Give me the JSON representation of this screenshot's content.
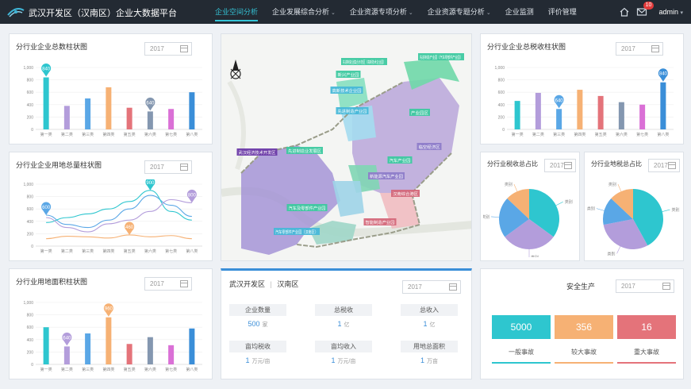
{
  "header": {
    "app_title": "武汉开发区（汉南区）企业大数据平台",
    "nav": [
      {
        "label": "企业空间分析",
        "active": true,
        "has_menu": false
      },
      {
        "label": "企业发展综合分析",
        "active": false,
        "has_menu": true
      },
      {
        "label": "企业资源专项分析",
        "active": false,
        "has_menu": true
      },
      {
        "label": "企业资源专题分析",
        "active": false,
        "has_menu": true
      },
      {
        "label": "企业监测",
        "active": false,
        "has_menu": false
      },
      {
        "label": "评价管理",
        "active": false,
        "has_menu": false
      }
    ],
    "notification_count": "10",
    "user": "admin",
    "user_caret": "▾"
  },
  "panels": {
    "enterprise_count": {
      "title": "分行业企业总数柱状图",
      "year": "2017"
    },
    "land_use": {
      "title": "分行业企业用地总量柱状图",
      "year": "2017"
    },
    "land_area": {
      "title": "分行业用地面积柱状图",
      "year": "2017"
    },
    "revenue": {
      "title": "分行业企业总税收柱状图",
      "year": "2017"
    },
    "pie_tax": {
      "title": "分行业税收总占比",
      "year": "2017"
    },
    "pie_land": {
      "title": "分行业地税总占比",
      "year": "2017"
    },
    "district": {
      "name1": "武汉开发区",
      "sep": "|",
      "name2": "汉南区",
      "year": "2017",
      "stats": [
        {
          "label": "企业数量",
          "value": "500",
          "unit": "家"
        },
        {
          "label": "总税收",
          "value": "1",
          "unit": "亿"
        },
        {
          "label": "总收入",
          "value": "1",
          "unit": "亿"
        },
        {
          "label": "亩均税收",
          "value": "1",
          "unit": "万元/亩"
        },
        {
          "label": "亩均收入",
          "value": "1",
          "unit": "万元/亩"
        },
        {
          "label": "用地总面积",
          "value": "1",
          "unit": "万亩"
        }
      ]
    },
    "safety": {
      "title": "安全生产",
      "year": "2017",
      "items": [
        {
          "value": "5000",
          "label": "一般事故",
          "color": "#2ec6cf"
        },
        {
          "value": "356",
          "label": "较大事故",
          "color": "#f6b174"
        },
        {
          "value": "16",
          "label": "重大事故",
          "color": "#e4737a"
        }
      ]
    }
  },
  "map": {
    "labels": [
      "先进制造业集合示范区（高新技术企业园）",
      "新兴产业园",
      "高新技术企业园",
      "先进制造产业园（汽车零部件产业园）",
      "先进制造产业园",
      "产业园区",
      "临空经济区",
      "武汉经济技术开发区",
      "先进制造业发展区",
      "汽车产业园",
      "新能源汽车产业园",
      "汽车及零部件产业园",
      "汽车零部件产业园（汉南区）",
      "汉南综合港区",
      "智能制造产业园"
    ]
  },
  "chart_data": [
    {
      "type": "bar",
      "title": "分行业企业总数柱状图",
      "categories": [
        "第一类",
        "第二类",
        "第三类",
        "第四类",
        "第五类",
        "第六类",
        "第七类",
        "第八类"
      ],
      "values": [
        840,
        380,
        500,
        680,
        350,
        290,
        330,
        600
      ],
      "colors": [
        "#2ec6cf",
        "#b39ddb",
        "#5aa7e6",
        "#f6b174",
        "#e4737a",
        "#8497b0",
        "#da70d6",
        "#3a8ed8"
      ],
      "callouts": [
        {
          "index": 0,
          "label": "840"
        },
        {
          "index": 5,
          "label": "640"
        }
      ],
      "ylim": [
        0,
        1000
      ],
      "yticks": [
        "0",
        "200",
        "400",
        "600",
        "800",
        "1,000"
      ]
    },
    {
      "type": "line",
      "title": "分行业企业用地总量柱状图",
      "categories": [
        "第一类",
        "第二类",
        "第三类",
        "第四类",
        "第五类",
        "第六类",
        "第七类",
        "第八类"
      ],
      "series": [
        {
          "color": "#5aa7e6",
          "values": [
            500,
            350,
            300,
            420,
            600,
            820,
            660,
            480
          ]
        },
        {
          "color": "#2ec6cf",
          "values": [
            380,
            460,
            520,
            600,
            720,
            900,
            560,
            420
          ]
        },
        {
          "color": "#b39ddb",
          "values": [
            460,
            300,
            230,
            360,
            420,
            560,
            750,
            700
          ]
        },
        {
          "color": "#f6b174",
          "values": [
            120,
            160,
            150,
            130,
            180,
            150,
            170,
            120
          ]
        }
      ],
      "callouts": [
        {
          "series": 0,
          "index": 0,
          "label": "600"
        },
        {
          "series": 1,
          "index": 5,
          "label": "900"
        },
        {
          "series": 3,
          "index": 4,
          "label": "460"
        },
        {
          "series": 2,
          "index": 7,
          "label": "800"
        }
      ],
      "ylim": [
        0,
        1000
      ],
      "yticks": [
        "0",
        "200",
        "400",
        "600",
        "800",
        "1,000"
      ]
    },
    {
      "type": "bar",
      "title": "分行业用地面积柱状图",
      "categories": [
        "第一类",
        "第二类",
        "第三类",
        "第四类",
        "第五类",
        "第六类",
        "第七类",
        "第八类"
      ],
      "values": [
        600,
        290,
        500,
        760,
        330,
        440,
        310,
        580
      ],
      "colors": [
        "#2ec6cf",
        "#b39ddb",
        "#5aa7e6",
        "#f6b174",
        "#e4737a",
        "#8497b0",
        "#da70d6",
        "#3a8ed8"
      ],
      "callouts": [
        {
          "index": 1,
          "label": "640"
        },
        {
          "index": 3,
          "label": "960"
        }
      ],
      "ylim": [
        0,
        1000
      ],
      "yticks": [
        "0",
        "200",
        "400",
        "600",
        "800",
        "1,000"
      ]
    },
    {
      "type": "bar",
      "title": "分行业企业总税收柱状图",
      "categories": [
        "第一类",
        "第二类",
        "第三类",
        "第四类",
        "第五类",
        "第六类",
        "第七类",
        "第八类"
      ],
      "values": [
        460,
        590,
        330,
        640,
        540,
        440,
        400,
        760
      ],
      "colors": [
        "#2ec6cf",
        "#b39ddb",
        "#5aa7e6",
        "#f6b174",
        "#e4737a",
        "#8497b0",
        "#da70d6",
        "#3a8ed8"
      ],
      "callouts": [
        {
          "index": 2,
          "label": "640"
        },
        {
          "index": 7,
          "label": "840"
        }
      ],
      "ylim": [
        0,
        1000
      ],
      "yticks": [
        "0",
        "200",
        "400",
        "600",
        "800",
        "1,000"
      ]
    },
    {
      "type": "pie",
      "title": "分行业税收总占比",
      "values": [
        35,
        30,
        22,
        13
      ],
      "colors": [
        "#2ec6cf",
        "#b39ddb",
        "#5aa7e6",
        "#f6b174"
      ],
      "labels": [
        "类别",
        "类别",
        "类别",
        "类别"
      ]
    },
    {
      "type": "pie",
      "title": "分行业地税总占比",
      "values": [
        42,
        30,
        15,
        13
      ],
      "colors": [
        "#2ec6cf",
        "#b39ddb",
        "#5aa7e6",
        "#f6b174"
      ],
      "labels": [
        "类别",
        "类别",
        "类别",
        "类别"
      ]
    }
  ]
}
